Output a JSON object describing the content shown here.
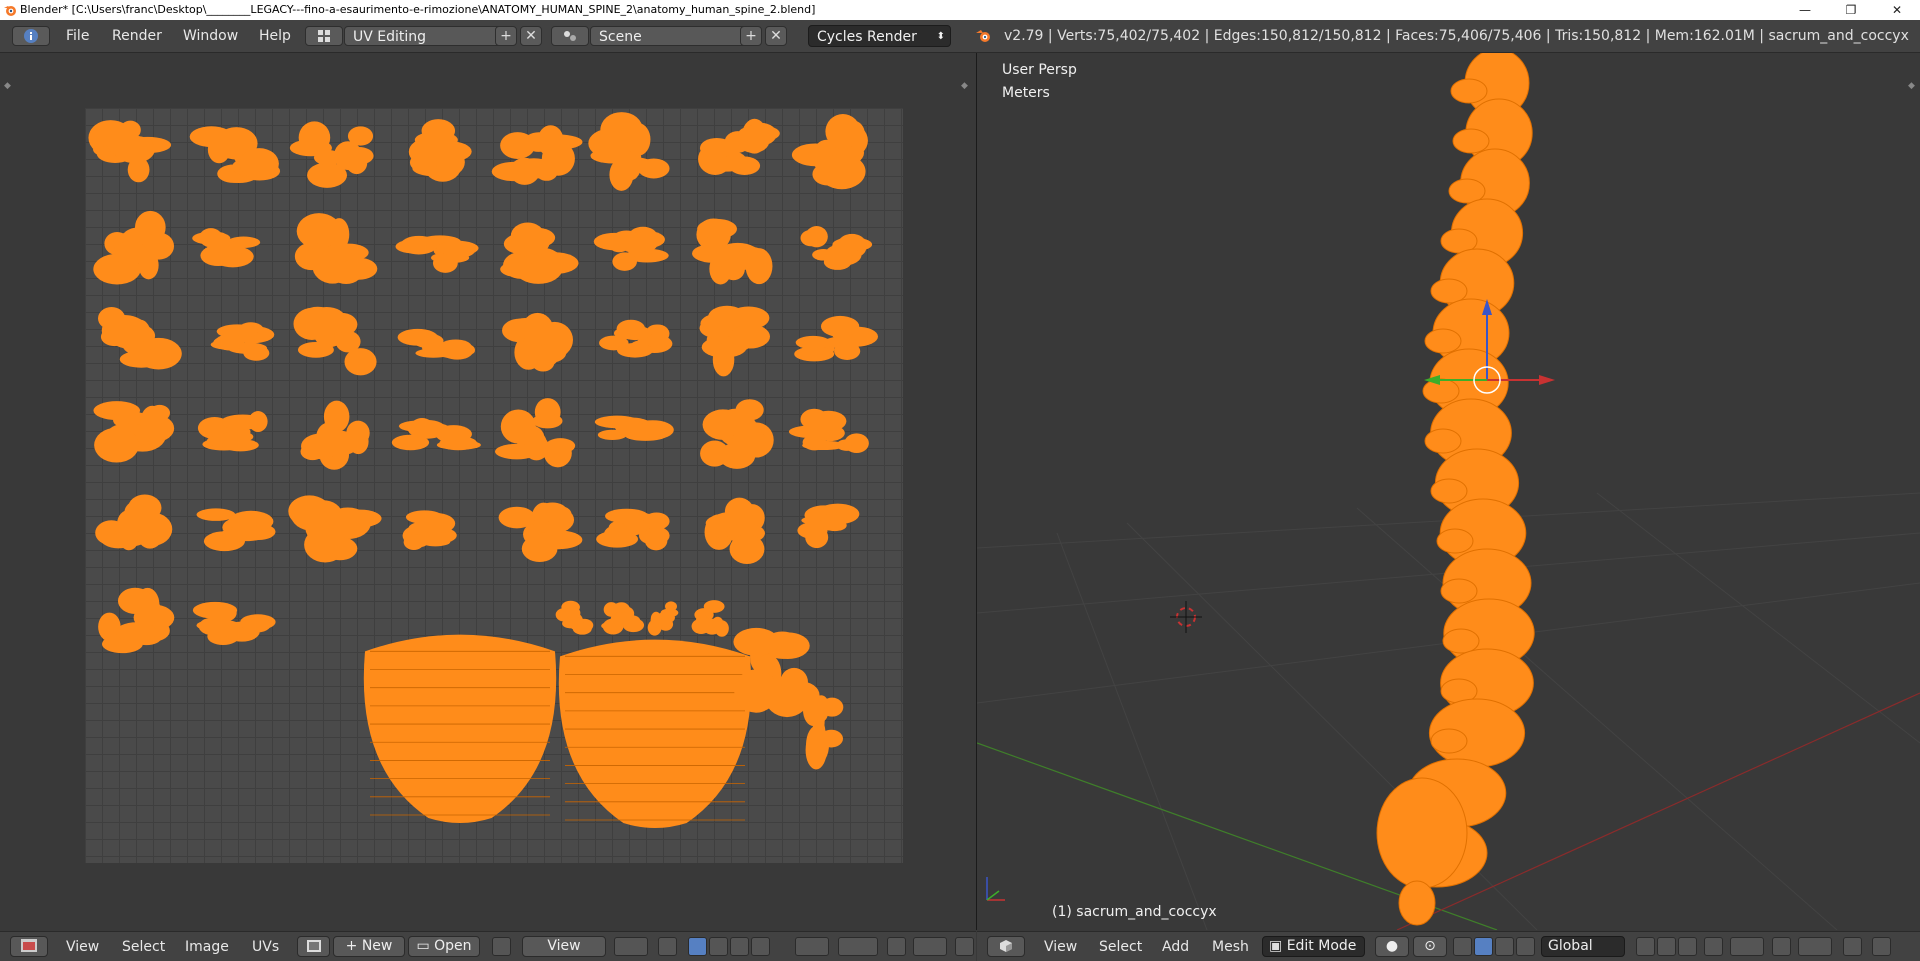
{
  "window": {
    "title": "Blender* [C:\\Users\\franc\\Desktop\\________LEGACY---fino-a-esaurimento-e-rimozione\\ANATOMY_HUMAN_SPINE_2\\anatomy_human_spine_2.blend]",
    "minimize": "—",
    "maximize": "❐",
    "close": "✕"
  },
  "infobar": {
    "menus": [
      "File",
      "Render",
      "Window",
      "Help"
    ],
    "screen_layout": "UV Editing",
    "scene": "Scene",
    "render_engine": "Cycles Render",
    "stats": "v2.79 | Verts:75,402/75,402 | Edges:150,812/150,812 | Faces:75,406/75,406 | Tris:150,812 | Mem:162.01M | sacrum_and_coccyx"
  },
  "uv_editor": {
    "menus": [
      "View",
      "Select",
      "Image",
      "UVs"
    ],
    "new_label": "New",
    "open_label": "Open",
    "view_label": "View"
  },
  "viewport": {
    "view_name": "User Persp",
    "units": "Meters",
    "object_label": "(1) sacrum_and_coccyx",
    "menus": [
      "View",
      "Select",
      "Add",
      "Mesh"
    ],
    "mode": "Edit Mode",
    "orientation": "Global"
  },
  "colors": {
    "uv_island": "#ff8c1a",
    "mesh": "#ff8c1a",
    "accent_blue": "#5680c2",
    "axis_red": "#c83232",
    "axis_green": "#4a9c2a"
  }
}
